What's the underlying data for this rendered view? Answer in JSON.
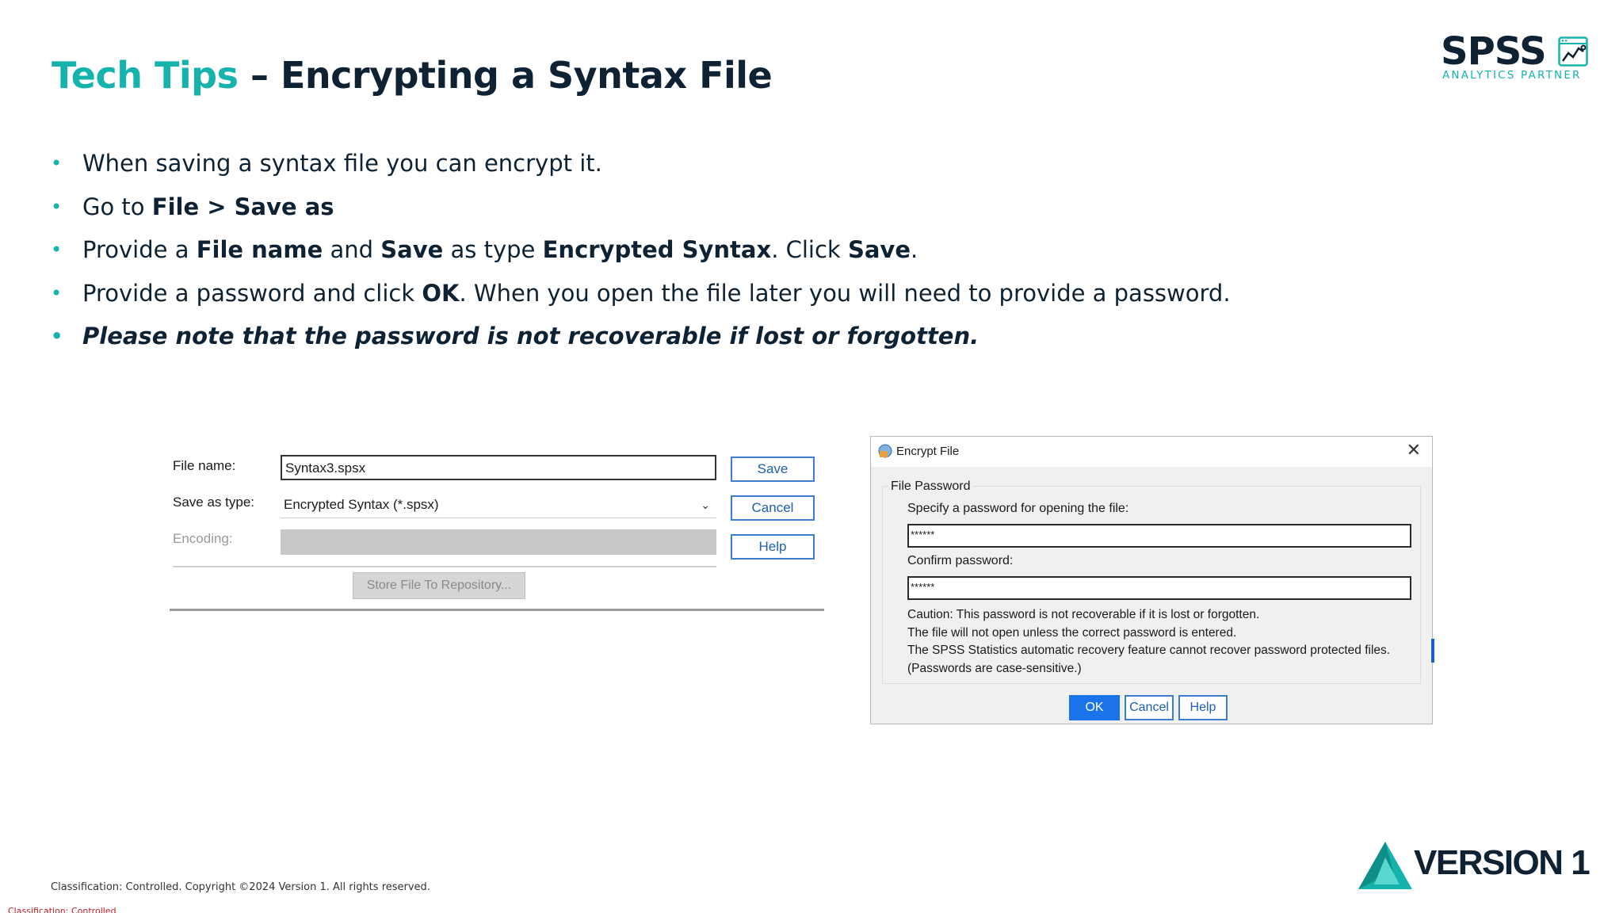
{
  "slide": {
    "title_accent": "Tech Tips",
    "title_rest": " – Encrypting a Syntax File",
    "brand": {
      "spss_word": "SPSS",
      "spss_tagline": "ANALYTICS PARTNER",
      "company_word": "VERSION 1",
      "accent_color": "#16b3ac",
      "dark_color": "#0f2233"
    },
    "bullets": [
      [
        "When saving a syntax file you can encrypt it."
      ],
      [
        "Go to ",
        {
          "b": "File > Save as"
        }
      ],
      [
        "Provide a ",
        {
          "b": "File name"
        },
        " and ",
        {
          "b": "Save"
        },
        " as type ",
        {
          "b": "Encrypted Syntax"
        },
        ". Click ",
        {
          "b": "Save"
        },
        "."
      ],
      [
        "Provide a password and click ",
        {
          "b": "OK"
        },
        ". When you open the file later you will need to provide a password."
      ]
    ],
    "note": "Please note that the password is not recoverable if lost or forgotten.",
    "footer": "Classification: Controlled. Copyright ©2024 Version 1. All rights reserved.",
    "classification": "Classification: Controlled"
  },
  "save_dialog": {
    "file_name_label": "File name:",
    "file_name_value": "Syntax3.spsx",
    "save_type_label": "Save as type:",
    "save_type_value": "Encrypted Syntax (*.spsx)",
    "encoding_label": "Encoding:",
    "store_button": "Store File To Repository...",
    "save_button": "Save",
    "cancel_button": "Cancel",
    "help_button": "Help"
  },
  "encrypt_dialog": {
    "title": "Encrypt File",
    "group_label": "File Password",
    "specify_label": "Specify a password for opening the file:",
    "password_value": "******",
    "confirm_label": "Confirm password:",
    "confirm_value": "******",
    "caution_lines": [
      "Caution: This password is not recoverable if it is lost or forgotten.",
      "The file will not open unless the correct password is entered.",
      "The SPSS Statistics automatic recovery feature cannot recover password protected files.",
      "(Passwords are case-sensitive.)"
    ],
    "ok_button": "OK",
    "cancel_button": "Cancel",
    "help_button": "Help"
  }
}
